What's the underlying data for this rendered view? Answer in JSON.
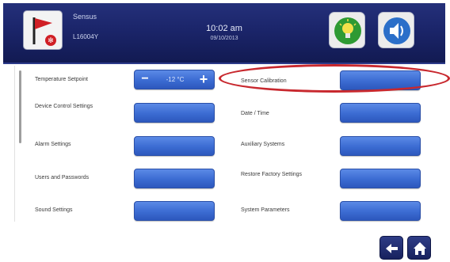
{
  "header": {
    "title": "Sensus",
    "subtitle": "L16004Y",
    "time": "10:02 am",
    "date": "09/10/2013"
  },
  "left_column": [
    {
      "label": "Temperature Setpoint",
      "control": "stepper",
      "value": "-12 °C"
    },
    {
      "label": "Device Control Settings",
      "control": "button"
    },
    {
      "label": "Alarm Settings",
      "control": "button"
    },
    {
      "label": "Users and Passwords",
      "control": "button"
    },
    {
      "label": "Sound Settings",
      "control": "button"
    }
  ],
  "right_column": [
    {
      "label": "Sensor Calibration",
      "highlighted": true
    },
    {
      "label": "Date / Time"
    },
    {
      "label": "Auxiliary Systems"
    },
    {
      "label": "Restore Factory Settings"
    },
    {
      "label": "System Parameters"
    }
  ],
  "colors": {
    "header_bg": "#1b256a",
    "button_blue": "#3b6bd2",
    "highlight_red": "#c8282e",
    "light_icon": "#3aa53a"
  },
  "icons": {
    "logo": "flag-logo-icon",
    "light": "light-bulb-icon",
    "sound": "speaker-icon",
    "back": "back-arrow-icon",
    "home": "home-icon"
  }
}
